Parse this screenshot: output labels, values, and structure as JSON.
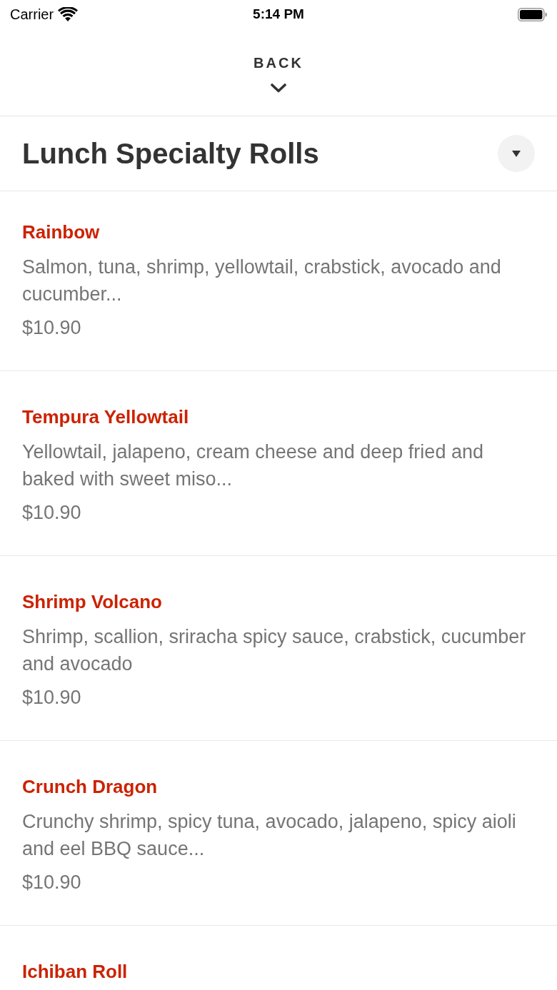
{
  "status_bar": {
    "carrier": "Carrier",
    "time": "5:14 PM"
  },
  "back_button": {
    "label": "BACK"
  },
  "section": {
    "title": "Lunch Specialty Rolls"
  },
  "items": [
    {
      "name": "Rainbow",
      "description": "Salmon, tuna, shrimp, yellowtail, crabstick, avocado and cucumber...",
      "price": "$10.90"
    },
    {
      "name": "Tempura Yellowtail",
      "description": "Yellowtail, jalapeno, cream cheese and deep fried and baked with sweet miso...",
      "price": "$10.90"
    },
    {
      "name": "Shrimp Volcano",
      "description": "Shrimp, scallion, sriracha spicy sauce, crabstick, cucumber and avocado",
      "price": "$10.90"
    },
    {
      "name": "Crunch Dragon",
      "description": "Crunchy shrimp, spicy tuna, avocado, jalapeno, spicy aioli and eel BBQ sauce...",
      "price": "$10.90"
    },
    {
      "name": "Ichiban Roll"
    }
  ]
}
